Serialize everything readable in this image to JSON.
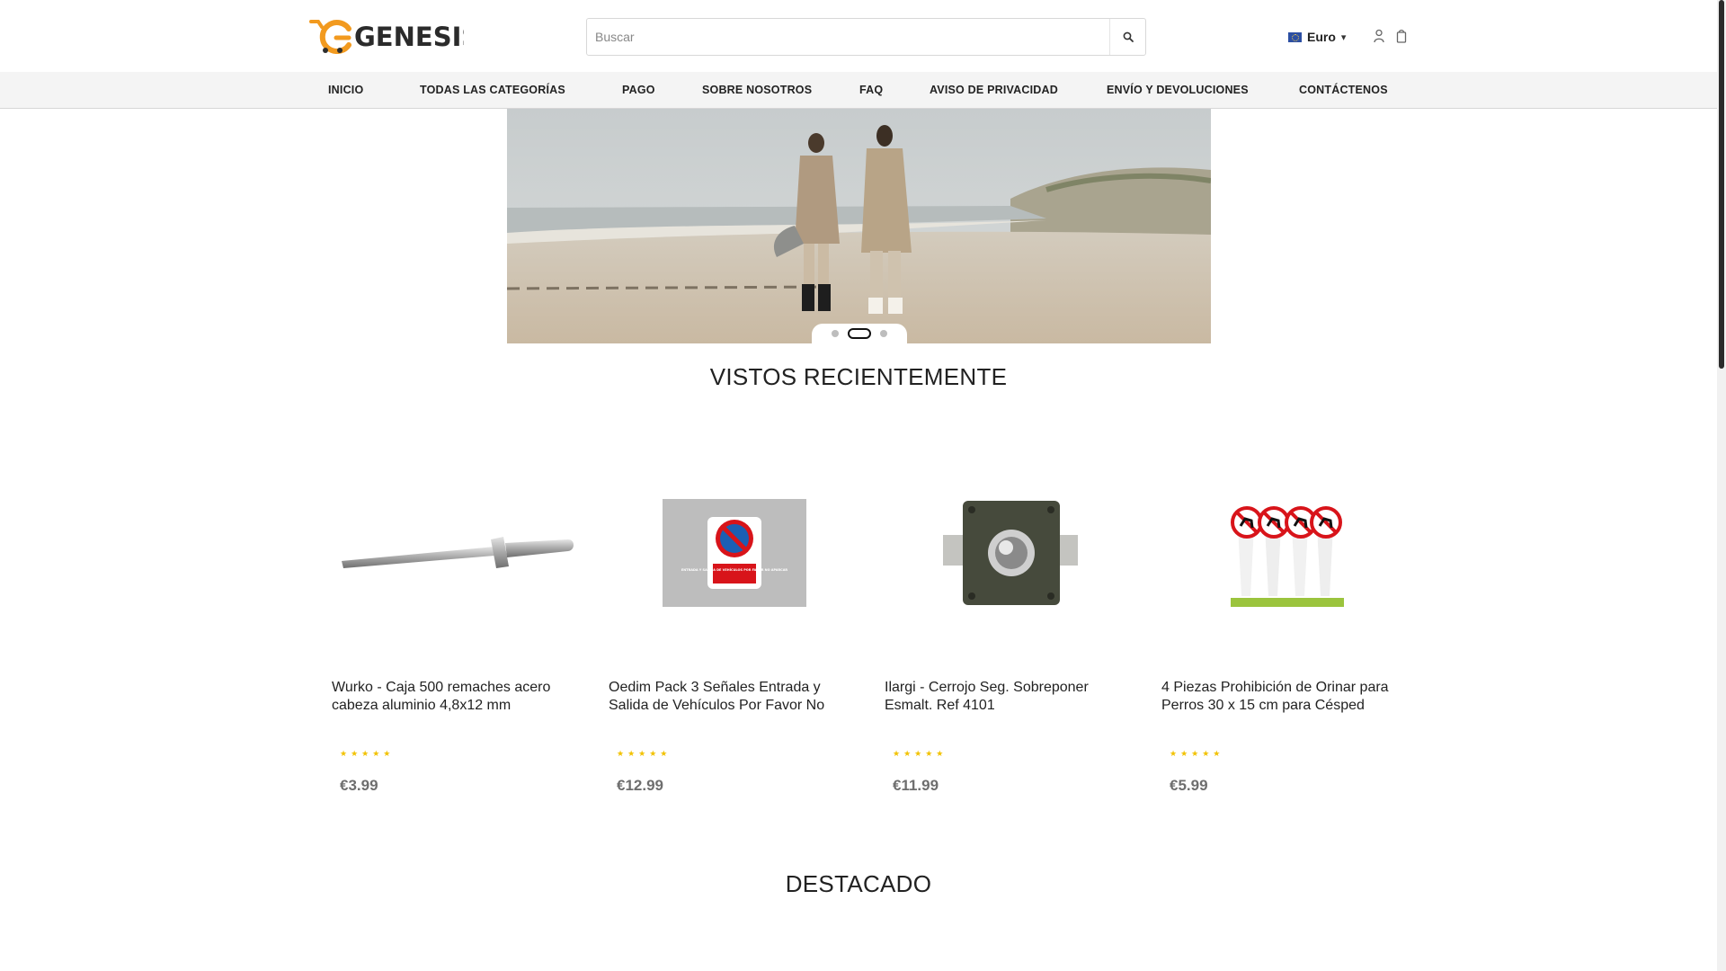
{
  "header": {
    "logo_text": "GENESIS",
    "search": {
      "placeholder": "Buscar",
      "value": ""
    },
    "currency": {
      "label": "Euro",
      "flag": "eu-flag-icon"
    },
    "icons": [
      "search-icon",
      "user-icon",
      "cart-icon"
    ]
  },
  "nav": {
    "items": [
      {
        "label": " INICIO"
      },
      {
        "label": "TODAS LAS CATEGORÍAS "
      },
      {
        "label": "PAGO"
      },
      {
        "label": "SOBRE NOSOTROS"
      },
      {
        "label": "FAQ"
      },
      {
        "label": "AVISO DE PRIVACIDAD"
      },
      {
        "label": "ENVÍO Y DEVOLUCIONES"
      },
      {
        "label": "CONTÁCTENOS"
      }
    ]
  },
  "banner": {
    "slides": 3,
    "active_slide": 2
  },
  "recent": {
    "title": "VISTOS RECIENTEMENTE",
    "products": [
      {
        "name": "Wurko - Caja 500 remaches acero cabeza aluminio 4,8x12 mm",
        "price": "€3.99",
        "rating": 0,
        "image": "rivet-image"
      },
      {
        "name": "Oedim Pack 3 Señales Entrada y Salida de Vehículos Por Favor No",
        "price": "€12.99",
        "rating": 0,
        "image": "no-parking-sign-image",
        "image_text": "ENTRADA Y SALIDA DE VEHÍCULOS POR FAVOR NO APARCAR"
      },
      {
        "name": "Ilargi - Cerrojo Seg. Sobreponer Esmalt. Ref 4101",
        "price": "€11.99",
        "rating": 0,
        "image": "door-bolt-lock-image"
      },
      {
        "name": "4 Piezas Prohibición de Orinar para Perros 30 x 15 cm para Césped",
        "price": "€5.99",
        "rating": 0,
        "image": "no-dog-pee-signs-image"
      }
    ]
  },
  "featured": {
    "title": "DESTACADO"
  },
  "colors": {
    "accent": "#f29a1f",
    "nav_bg": "#f4f4f4",
    "price": "#6e6e6e",
    "star": "#f2c200"
  }
}
